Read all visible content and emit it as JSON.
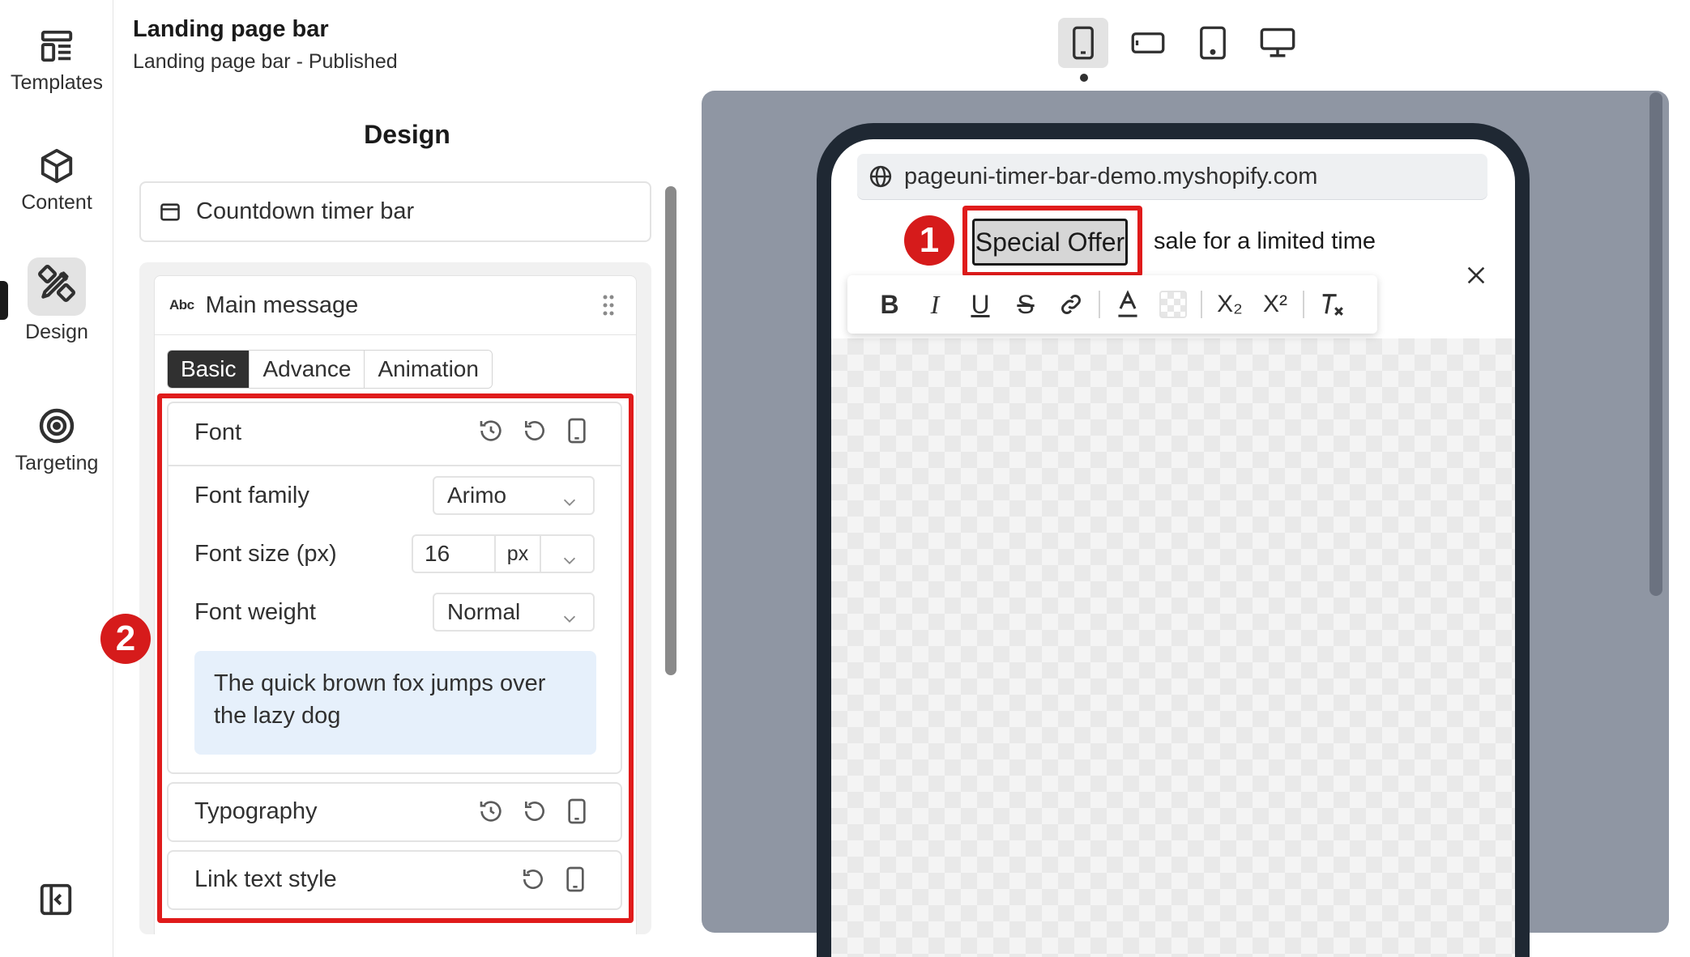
{
  "sidebar": {
    "items": [
      {
        "label": "Templates",
        "icon": "templates-icon"
      },
      {
        "label": "Content",
        "icon": "cube-icon"
      },
      {
        "label": "Design",
        "icon": "design-tools-icon",
        "active": true
      },
      {
        "label": "Targeting",
        "icon": "target-icon"
      }
    ],
    "collapse_icon": "collapse-sidebar-icon"
  },
  "header": {
    "title": "Landing page bar",
    "subtitle": "Landing page bar - Published"
  },
  "panel": {
    "title": "Design",
    "block_selector": "Countdown timer bar",
    "section_title": "Main message",
    "section_abbr": "Abc",
    "tabs": [
      {
        "label": "Basic",
        "active": true
      },
      {
        "label": "Advance"
      },
      {
        "label": "Animation"
      }
    ],
    "font": {
      "heading": "Font",
      "family_label": "Font family",
      "family_value": "Arimo",
      "size_label": "Font size (px)",
      "size_value": "16",
      "size_unit": "px",
      "weight_label": "Font weight",
      "weight_value": "Normal",
      "preview_text": "The quick brown fox jumps over the lazy dog"
    },
    "typography_heading": "Typography",
    "link_style_heading": "Link text style"
  },
  "annotations": {
    "badge1": "1",
    "badge2": "2",
    "highlight_color": "#e01b1b"
  },
  "preview": {
    "devices": [
      "mobile",
      "mobile-landscape",
      "tablet",
      "desktop"
    ],
    "active_device": "mobile",
    "url": "pageuni-timer-bar-demo.myshopify.com",
    "offer_text": "Special Offer",
    "bar_text": "sale for a limited time",
    "toolbar": {
      "bold": "B",
      "italic": "I",
      "underline": "U",
      "strike": "S",
      "subscript": "X₂",
      "superscript": "X²"
    }
  }
}
